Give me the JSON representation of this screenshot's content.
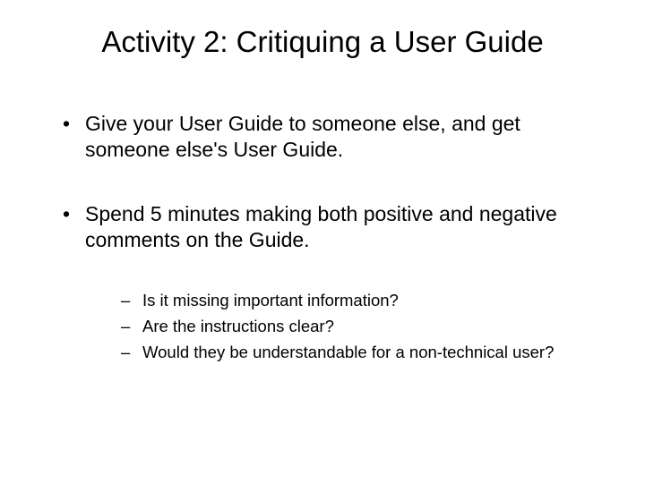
{
  "title": "Activity 2: Critiquing a User Guide",
  "bullets": [
    "Give your User Guide to someone else, and get someone else's User Guide.",
    "Spend 5 minutes making both positive and negative comments on the Guide."
  ],
  "sub_bullets": [
    "Is it missing important information?",
    "Are the instructions clear?",
    "Would they be understandable for a non-technical user?"
  ]
}
